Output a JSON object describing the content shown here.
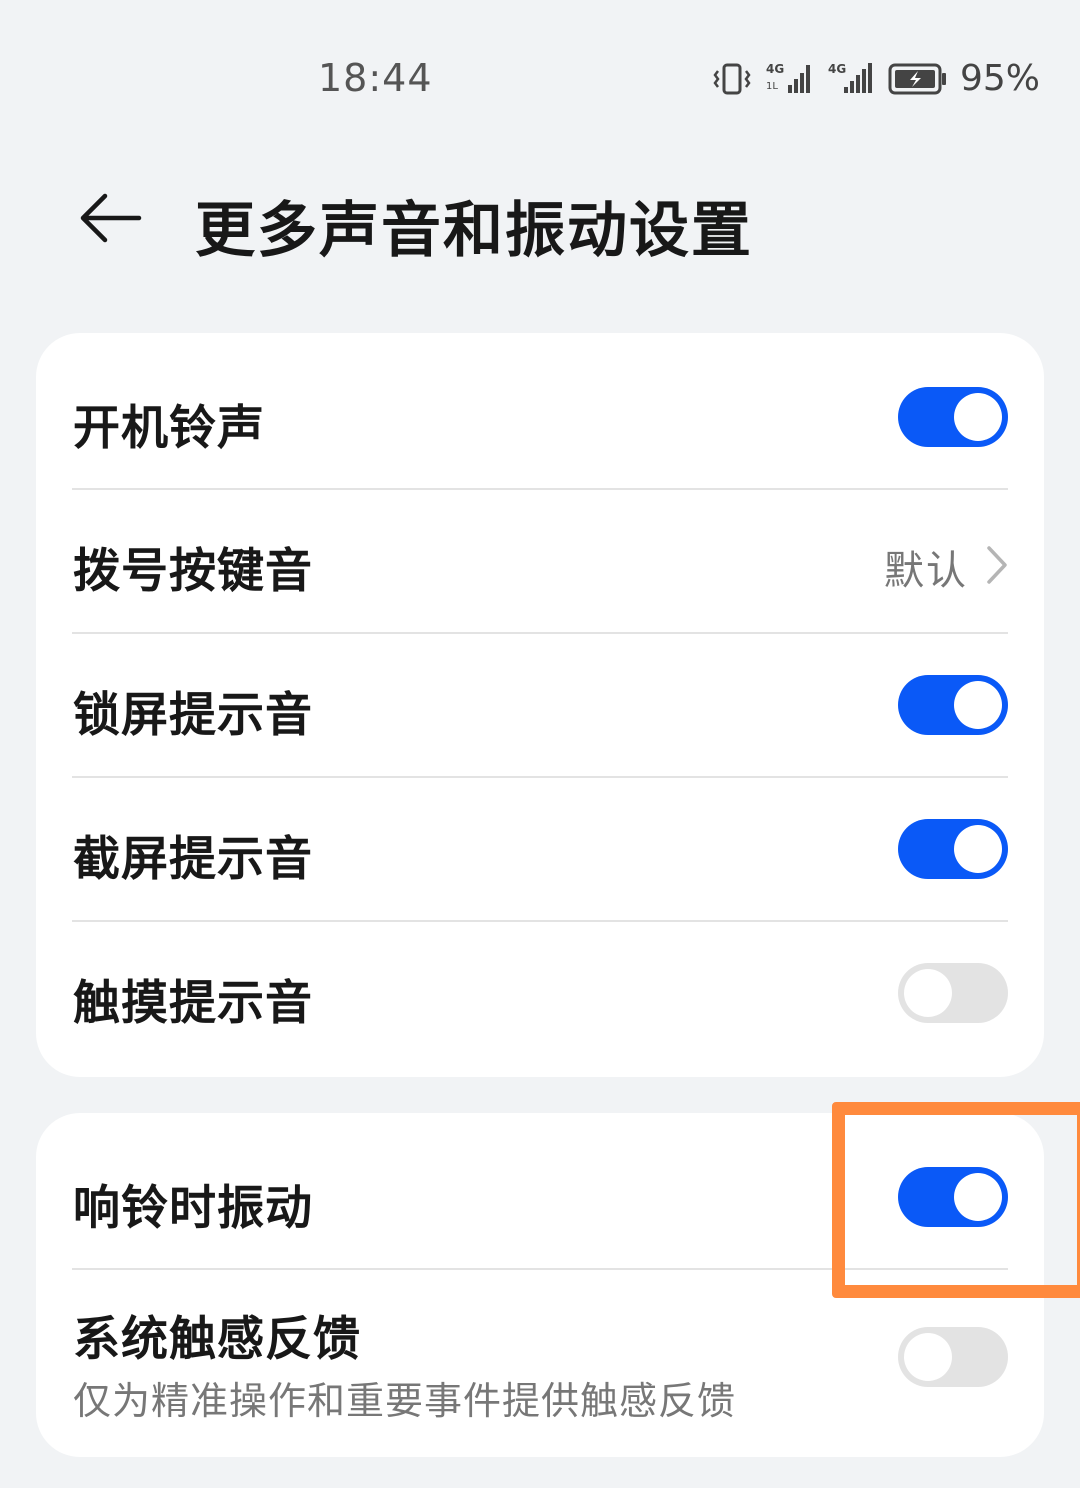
{
  "status_bar": {
    "time": "18:44",
    "battery_percent": "95%",
    "icons": [
      "vibrate-icon",
      "signal-4g-icon",
      "signal-4g-icon",
      "battery-charging-icon"
    ]
  },
  "header": {
    "title": "更多声音和振动设置",
    "back_icon": "arrow-left-icon"
  },
  "section1": {
    "boot_ringtone": {
      "label": "开机铃声",
      "enabled": true
    },
    "dial_pad_tone": {
      "label": "拨号按键音",
      "value": "默认"
    },
    "lock_screen_sound": {
      "label": "锁屏提示音",
      "enabled": true
    },
    "screenshot_sound": {
      "label": "截屏提示音",
      "enabled": true
    },
    "touch_sound": {
      "label": "触摸提示音",
      "enabled": false
    }
  },
  "section2": {
    "vibrate_on_ring": {
      "label": "响铃时振动",
      "enabled": true
    },
    "system_haptics": {
      "label": "系统触感反馈",
      "description": "仅为精准操作和重要事件提供触感反馈",
      "enabled": false
    }
  },
  "colors": {
    "accent": "#0a59f7",
    "toggle_off": "#e3e3e3",
    "highlight": "#ff8a3d",
    "background": "#f1f3f5"
  }
}
